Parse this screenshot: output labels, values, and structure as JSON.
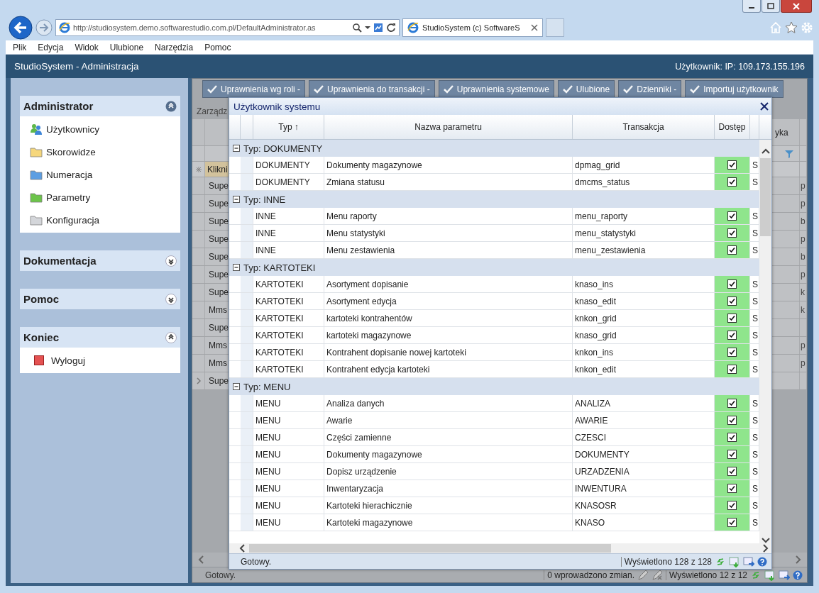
{
  "browser": {
    "address": "http://studiosystem.demo.softwarestudio.com.pl/DefaultAdministrator.as",
    "tabs": [
      {
        "title": "StudioSystem (c) SoftwareS",
        "selected": true
      }
    ]
  },
  "menu": [
    "Plik",
    "Edycja",
    "Widok",
    "Ulubione",
    "Narzędzia",
    "Pomoc"
  ],
  "app": {
    "title": "StudioSystem - Administracja",
    "user": "Użytkownik: IP: 109.173.155.196"
  },
  "sidebar": {
    "panels": [
      {
        "title": "Administrator",
        "expanded": true,
        "items": [
          {
            "label": "Użytkownicy",
            "kind": "users"
          },
          {
            "label": "Skorowidze",
            "kind": "folder",
            "color": "#f6d77c"
          },
          {
            "label": "Numeracja",
            "kind": "folder",
            "color": "#5c9ee2"
          },
          {
            "label": "Parametry",
            "kind": "folder",
            "color": "#6cc44a"
          },
          {
            "label": "Konfiguracja",
            "kind": "folder",
            "color": "#d4d6da"
          }
        ]
      },
      {
        "title": "Dokumentacja",
        "expanded": false
      },
      {
        "title": "Pomoc",
        "expanded": false
      },
      {
        "title": "Koniec",
        "expanded": true,
        "items": [
          {
            "label": "Wyloguj",
            "kind": "stop"
          }
        ]
      }
    ]
  },
  "toolbar": [
    "Uprawnienia wg roli -",
    "Uprawnienia do transakcji -",
    "Uprawnienia systemowe",
    "Ulubione",
    "Dzienniki -",
    "Importuj użytkownik"
  ],
  "background_grid": {
    "caption": "Zarządz",
    "column_4": "yka",
    "new_row": "Klikni",
    "rows": [
      {
        "column_1": "Supe",
        "column_4": "p",
        "selected": false
      },
      {
        "column_1": "Supe",
        "column_4": "p",
        "selected": false
      },
      {
        "column_1": "Supe",
        "column_4": "b",
        "selected": false
      },
      {
        "column_1": "Supe",
        "column_4": "p",
        "selected": false
      },
      {
        "column_1": "Supe",
        "column_4": "b",
        "selected": false
      },
      {
        "column_1": "Supe",
        "column_4": "p",
        "selected": false
      },
      {
        "column_1": "Supe",
        "column_4": "k",
        "selected": false
      },
      {
        "column_1": "Mms",
        "column_4": "k",
        "selected": false
      },
      {
        "column_1": "Supe",
        "selected": false
      },
      {
        "column_1": "Mms",
        "column_4": "p",
        "selected": false
      },
      {
        "column_1": "Mms",
        "column_4": "p",
        "selected": false
      },
      {
        "column_1": "Supe",
        "selected": true
      }
    ],
    "status": "Gotowy.",
    "changes": "0 wprowadzono zmian.",
    "count": "Wyświetlono 12 z 12"
  },
  "dialog": {
    "title": "Użytkownik systemu",
    "columns": [
      {
        "label": "Typ",
        "sort_marker": "↑"
      },
      {
        "label": "Nazwa parametru"
      },
      {
        "label": "Transakcja"
      },
      {
        "label": "Dostęp"
      }
    ],
    "groups": [
      {
        "label": "Typ: DOKUMENTY",
        "expanded": true,
        "rows": [
          {
            "type": "DOKUMENTY",
            "name": "Dokumenty magazynowe",
            "transaction": "dpmag_grid",
            "access": true,
            "column_5": "S"
          },
          {
            "type": "DOKUMENTY",
            "name": "Zmiana statusu",
            "transaction": "dmcms_status",
            "access": true,
            "column_5": "S"
          }
        ]
      },
      {
        "label": "Typ: INNE",
        "expanded": true,
        "rows": [
          {
            "type": "INNE",
            "name": "Menu raporty",
            "transaction": "menu_raporty",
            "access": true,
            "column_5": "S"
          },
          {
            "type": "INNE",
            "name": "Menu statystyki",
            "transaction": "menu_statystyki",
            "access": true,
            "column_5": "S"
          },
          {
            "type": "INNE",
            "name": "Menu zestawienia",
            "transaction": "menu_zestawienia",
            "access": true,
            "column_5": "S"
          }
        ]
      },
      {
        "label": "Typ: KARTOTEKI",
        "expanded": true,
        "rows": [
          {
            "type": "KARTOTEKI",
            "name": "Asortyment dopisanie",
            "transaction": "knaso_ins",
            "access": true,
            "column_5": "S"
          },
          {
            "type": "KARTOTEKI",
            "name": "Asortyment edycja",
            "transaction": "knaso_edit",
            "access": true,
            "column_5": "S"
          },
          {
            "type": "KARTOTEKI",
            "name": "kartoteki kontrahentów",
            "transaction": "knkon_grid",
            "access": true,
            "column_5": "S"
          },
          {
            "type": "KARTOTEKI",
            "name": "kartoteki magazynowe",
            "transaction": "knaso_grid",
            "access": true,
            "column_5": "S"
          },
          {
            "type": "KARTOTEKI",
            "name": "Kontrahent dopisanie nowej kartoteki",
            "transaction": "knkon_ins",
            "access": true,
            "column_5": "S"
          },
          {
            "type": "KARTOTEKI",
            "name": "Kontrahent edycja kartoteki",
            "transaction": "knkon_edit",
            "access": true,
            "column_5": "S"
          }
        ]
      },
      {
        "label": "Typ: MENU",
        "expanded": true,
        "rows": [
          {
            "type": "MENU",
            "name": "Analiza danych",
            "transaction": "ANALIZA",
            "access": true,
            "column_5": "S"
          },
          {
            "type": "MENU",
            "name": "Awarie",
            "transaction": "AWARIE",
            "access": true,
            "column_5": "S"
          },
          {
            "type": "MENU",
            "name": "Części zamienne",
            "transaction": "CZESCI",
            "access": true,
            "column_5": "S"
          },
          {
            "type": "MENU",
            "name": "Dokumenty magazynowe",
            "transaction": "DOKUMENTY",
            "access": true,
            "column_5": "S"
          },
          {
            "type": "MENU",
            "name": "Dopisz urządzenie",
            "transaction": "URZADZENIA",
            "access": true,
            "column_5": "S"
          },
          {
            "type": "MENU",
            "name": "Inwentaryzacja",
            "transaction": "INWENTURA",
            "access": true,
            "column_5": "S"
          },
          {
            "type": "MENU",
            "name": "Kartoteki hierachicznie",
            "transaction": "KNASOSR",
            "access": true,
            "column_5": "S"
          },
          {
            "type": "MENU",
            "name": "Kartoteki magazynowe",
            "transaction": "KNASO",
            "access": true,
            "column_5": "S"
          }
        ]
      }
    ],
    "status": "Gotowy.",
    "count": "Wyświetlono 128 z 128"
  }
}
